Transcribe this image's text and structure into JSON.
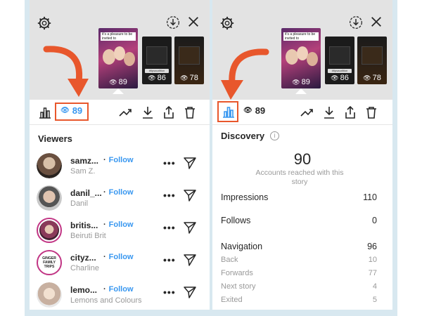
{
  "left_panel": {
    "story_counts": [
      "89",
      "86",
      "78"
    ],
    "story_banner": [
      "it's a pleasure to be",
      "invited to"
    ],
    "story_tag": "#tipsaudition",
    "view_count": "89",
    "section_title": "Viewers",
    "viewers": [
      {
        "name": "samz...",
        "follow": "Follow",
        "sub": "Sam Z."
      },
      {
        "name": "danil_...",
        "follow": "Follow",
        "sub": "Danil"
      },
      {
        "name": "britis...",
        "follow": "Follow",
        "sub": "Beiruti Brit"
      },
      {
        "name": "cityz...",
        "follow": "Follow",
        "sub": "Charline",
        "avatar_text": [
          "GINGER",
          "FAMILY",
          "TRIPS"
        ]
      },
      {
        "name": "lemo...",
        "follow": "Follow",
        "sub": "Lemons and Colours"
      }
    ],
    "more_label": "•••"
  },
  "right_panel": {
    "story_counts": [
      "89",
      "86",
      "78"
    ],
    "story_banner": [
      "it's a pleasure to be",
      "invited to"
    ],
    "story_tag": "#tipsaudition",
    "view_count": "89",
    "section_title": "Discovery",
    "reach_number": "90",
    "reach_label": "Accounts reached with this story",
    "stats": [
      {
        "label": "Impressions",
        "value": "110"
      },
      {
        "label": "Follows",
        "value": "0"
      },
      {
        "label": "Navigation",
        "value": "96"
      }
    ],
    "nav_stats": [
      {
        "label": "Back",
        "value": "10"
      },
      {
        "label": "Forwards",
        "value": "77"
      },
      {
        "label": "Next story",
        "value": "4"
      },
      {
        "label": "Exited",
        "value": "5"
      }
    ]
  },
  "colors": {
    "accent_orange": "#e8572c",
    "link_blue": "#3897f0",
    "frame": "#d8e8f0"
  }
}
